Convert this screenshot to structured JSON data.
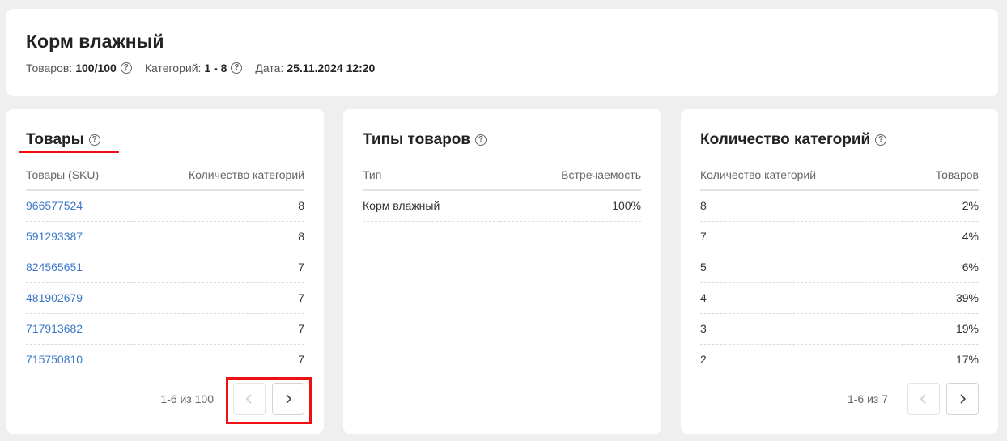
{
  "header": {
    "title": "Корм влажный",
    "products_label": "Товаров:",
    "products_value": "100/100",
    "categories_label": "Категорий:",
    "categories_value": "1 - 8",
    "date_label": "Дата:",
    "date_value": "25.11.2024 12:20"
  },
  "products": {
    "title": "Товары",
    "columns": [
      "Товары (SKU)",
      "Количество категорий"
    ],
    "rows": [
      {
        "sku": "966577524",
        "count": "8"
      },
      {
        "sku": "591293387",
        "count": "8"
      },
      {
        "sku": "824565651",
        "count": "7"
      },
      {
        "sku": "481902679",
        "count": "7"
      },
      {
        "sku": "717913682",
        "count": "7"
      },
      {
        "sku": "715750810",
        "count": "7"
      }
    ],
    "pagination": "1-6 из 100"
  },
  "types": {
    "title": "Типы товаров",
    "columns": [
      "Тип",
      "Встречаемость"
    ],
    "rows": [
      {
        "type": "Корм влажный",
        "share": "100%"
      }
    ]
  },
  "categories": {
    "title": "Количество категорий",
    "columns": [
      "Количество категорий",
      "Товаров"
    ],
    "rows": [
      {
        "count": "8",
        "share": "2%"
      },
      {
        "count": "7",
        "share": "4%"
      },
      {
        "count": "5",
        "share": "6%"
      },
      {
        "count": "4",
        "share": "39%"
      },
      {
        "count": "3",
        "share": "19%"
      },
      {
        "count": "2",
        "share": "17%"
      }
    ],
    "pagination": "1-6 из 7"
  },
  "icons": {
    "help": "question-circle-icon",
    "prev": "chevron-left-icon",
    "next": "chevron-right-icon"
  },
  "colors": {
    "link": "#3c78c8",
    "highlight": "#e11111"
  }
}
